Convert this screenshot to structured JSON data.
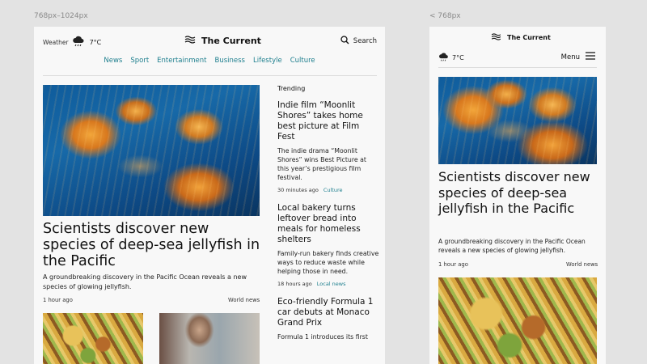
{
  "labels": {
    "tablet": "768px–1024px",
    "mobile": "< 768px"
  },
  "site": {
    "name": "The Current"
  },
  "weather": {
    "label": "Weather",
    "temp": "7°C"
  },
  "search": {
    "label": "Search"
  },
  "menu": {
    "label": "Menu"
  },
  "nav": [
    "News",
    "Sport",
    "Entertainment",
    "Business",
    "Lifestyle",
    "Culture"
  ],
  "hero": {
    "title": "Scientists discover new species of deep-sea jellyfish in the Pacific",
    "description": "A groundbreaking discovery in the Pacific Ocean reveals a new species of glowing jellyfish.",
    "time": "1 hour ago",
    "tag": "World news"
  },
  "trending": {
    "heading": "Trending",
    "stories": [
      {
        "title": "Indie film “Moonlit Shores” takes home best picture at Film Fest",
        "description": "The indie drama “Moonlit Shores” wins Best Picture at this year’s prestigious film festival.",
        "time": "30 minutes ago",
        "category": "Culture"
      },
      {
        "title": "Local bakery turns leftover bread into meals for homeless shelters",
        "description": "Family-run bakery finds creative ways to reduce waste while helping those in need.",
        "time": "18 hours ago",
        "category": "Local news"
      },
      {
        "title": "Eco-friendly Formula 1 car debuts at Monaco Grand Prix",
        "description": "Formula 1 introduces its first"
      }
    ]
  },
  "colors": {
    "accent": "#1e7f8e",
    "background": "#e3e3e3",
    "frame": "#f8f8f8"
  },
  "icons": [
    "cloud-rain-icon",
    "waves-logo-icon",
    "search-icon",
    "menu-icon"
  ]
}
